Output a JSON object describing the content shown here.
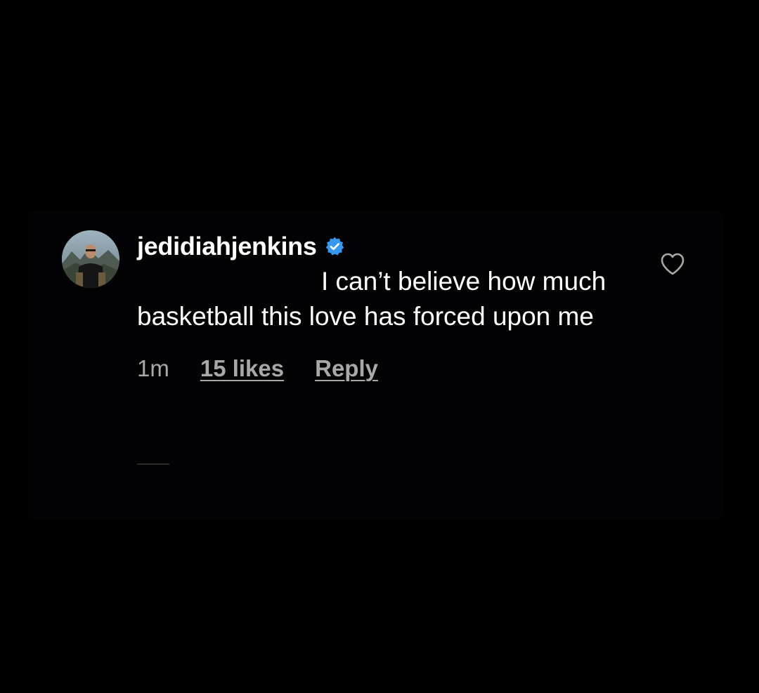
{
  "comment": {
    "username": "jedidiahjenkins",
    "verified_icon": "verified-badge-icon",
    "text": "I can’t believe how much basketball this love has forced upon me",
    "time": "1m",
    "likes_label": "15 likes",
    "reply_label": "Reply",
    "like_icon": "heart-outline-icon"
  },
  "colors": {
    "background": "#000000",
    "text": "#ffffff",
    "secondary_text": "#a8a8a8",
    "verified_blue": "#3897f0"
  }
}
